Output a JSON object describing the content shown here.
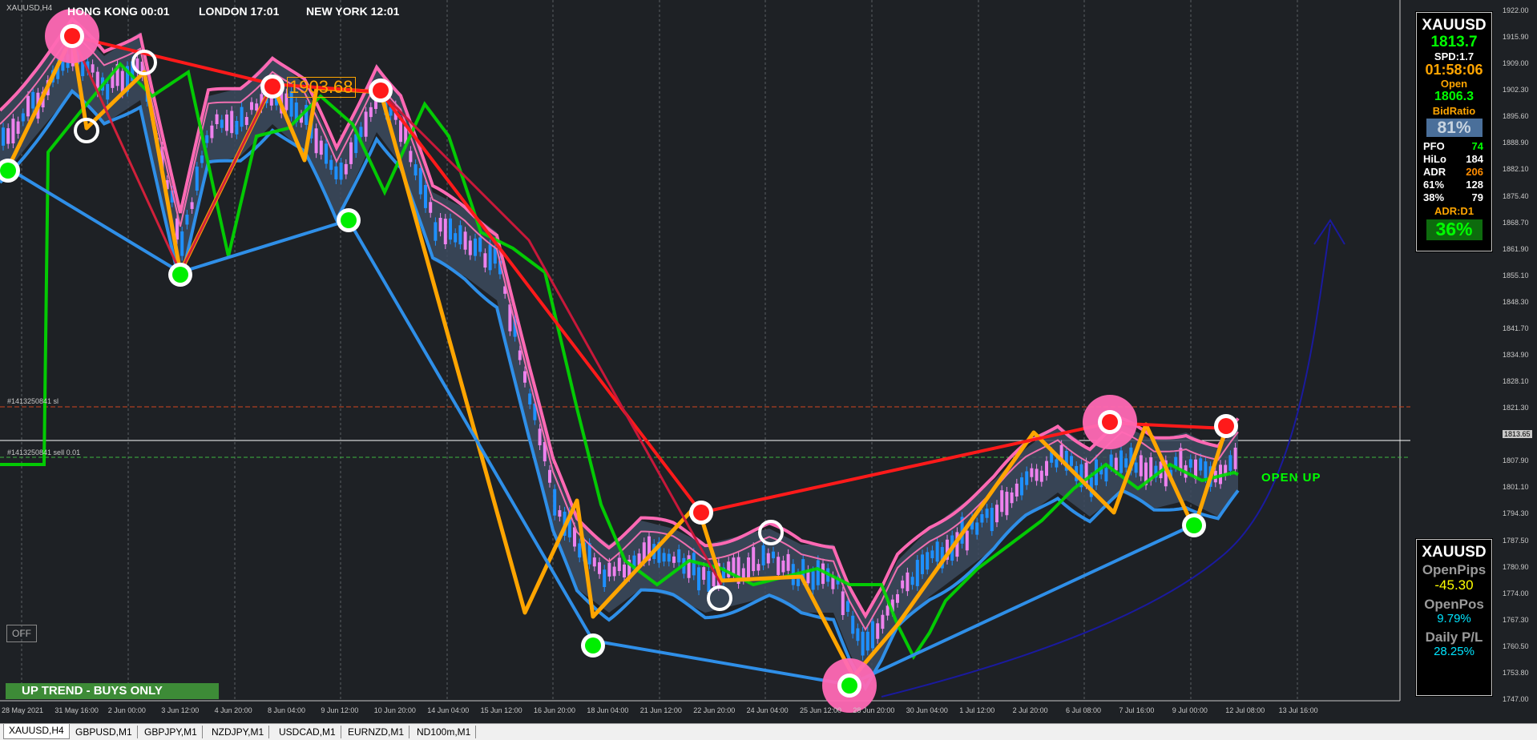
{
  "window": {
    "symbol_label": "XAUUSD,H4"
  },
  "clocks": [
    {
      "label": "HONG KONG 00:01",
      "bg": "#b1272a"
    },
    {
      "label": "LONDON  17:01",
      "bg": "#b1272a"
    },
    {
      "label": "NEW YORK 12:01",
      "bg": "#1e7fd8"
    }
  ],
  "info_panel": {
    "symbol": "XAUUSD",
    "price": "1813.7",
    "spread": "SPD:1.7",
    "countdown": "01:58:06",
    "open_label": "Open",
    "open_value": "1806.3",
    "bidratio_label": "BidRatio",
    "bidratio_value": "81%",
    "stats": [
      {
        "label": "PFO",
        "value": "74",
        "color": "#00ff00"
      },
      {
        "label": "HiLo",
        "value": "184",
        "color": "#ffffff"
      },
      {
        "label": "ADR",
        "value": "206",
        "color": "#ff8c00"
      },
      {
        "label": "61%",
        "value": "128",
        "color": "#ffffff"
      },
      {
        "label": "38%",
        "value": "79",
        "color": "#ffffff"
      }
    ],
    "adr_label": "ADR:D1",
    "adr_value": "36%"
  },
  "pnl_panel": {
    "symbol": "XAUUSD",
    "open_pips_label": "OpenPips",
    "open_pips_value": "-45.30",
    "open_pos_label": "OpenPos",
    "open_pos_value": "9.79%",
    "daily_label": "Daily P/L",
    "daily_value": "28.25%"
  },
  "annotations": {
    "price_tag": "1903.68",
    "sl_line": "#1413250841 sl",
    "entry_line": "#1413250841 sell 0.01",
    "open_up": "OPEN UP",
    "trend_banner": "UP TREND - BUYS ONLY",
    "off_button": "OFF"
  },
  "price_axis": [
    "1922.00",
    "1915.90",
    "1909.00",
    "1902.30",
    "1895.60",
    "1888.90",
    "1882.10",
    "1875.40",
    "1868.70",
    "1861.90",
    "1855.10",
    "1848.30",
    "1841.70",
    "1834.90",
    "1828.10",
    "1821.30",
    "1813.65",
    "1807.90",
    "1801.10",
    "1794.30",
    "1787.50",
    "1780.90",
    "1774.00",
    "1767.30",
    "1760.50",
    "1753.80",
    "1747.00"
  ],
  "time_axis": [
    "28 May 2021",
    "31 May 16:00",
    "2 Jun 00:00",
    "3 Jun 12:00",
    "4 Jun 20:00",
    "8 Jun 04:00",
    "9 Jun 12:00",
    "10 Jun 20:00",
    "14 Jun 04:00",
    "15 Jun 12:00",
    "16 Jun 20:00",
    "18 Jun 04:00",
    "21 Jun 12:00",
    "22 Jun 20:00",
    "24 Jun 04:00",
    "25 Jun 12:00",
    "28 Jun 20:00",
    "30 Jun 04:00",
    "1 Jul 12:00",
    "2 Jul 20:00",
    "6 Jul 08:00",
    "7 Jul 16:00",
    "9 Jul 00:00",
    "12 Jul 08:00",
    "13 Jul 16:00"
  ],
  "tabs": [
    "XAUUSD,H4",
    "GBPUSD,M1",
    "GBPJPY,M1",
    "NZDJPY,M1",
    "USDCAD,M1",
    "EURNZD,M1",
    "ND100m,M1"
  ],
  "colors": {
    "bg": "#1e2125",
    "bull": "#1e90ff",
    "bear": "#ee82ee",
    "band_pink": "#ff69b4",
    "band_blue": "#2f8fe8",
    "zigzag": "#ffa500",
    "ma": "#00dd00",
    "red_line": "#ff1a1a",
    "forecast": "#1a1a9e"
  }
}
